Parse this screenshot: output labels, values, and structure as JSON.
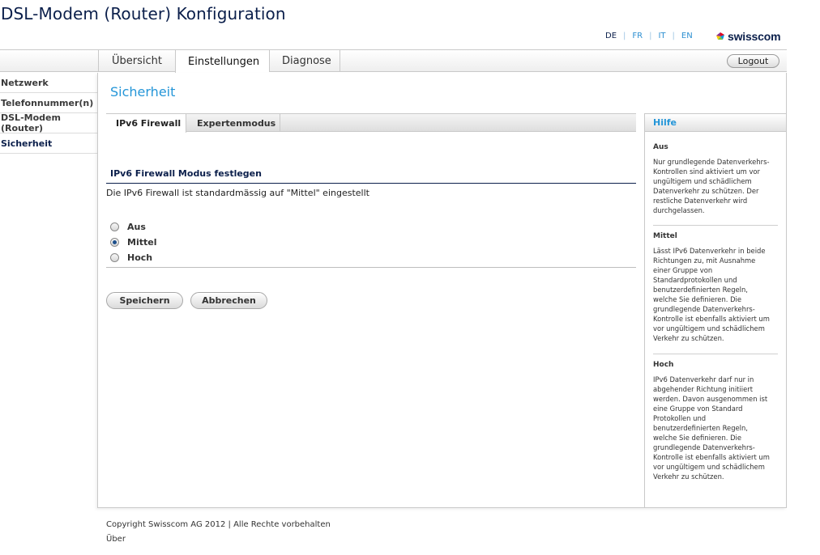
{
  "app": {
    "title": "DSL-Modem (Router) Konfiguration"
  },
  "languages": [
    {
      "code": "DE",
      "active": true
    },
    {
      "code": "FR",
      "active": false
    },
    {
      "code": "IT",
      "active": false
    },
    {
      "code": "EN",
      "active": false
    }
  ],
  "brand": {
    "name": "swisscom",
    "colors": [
      "#e2001a",
      "#0099dd",
      "#7ac143",
      "#ffcc00"
    ]
  },
  "nav": {
    "tabs": [
      {
        "label": "Übersicht"
      },
      {
        "label": "Einstellungen"
      },
      {
        "label": "Diagnose"
      }
    ],
    "logout_label": "Logout"
  },
  "sidebar": {
    "items": [
      {
        "label": "Netzwerk"
      },
      {
        "label": "Telefonnummer(n)"
      },
      {
        "label": "DSL-Modem (Router)"
      },
      {
        "label": "Sicherheit"
      }
    ]
  },
  "main": {
    "page_title": "Sicherheit",
    "subtabs": [
      {
        "label": "IPv6 Firewall"
      },
      {
        "label": "Expertenmodus"
      }
    ],
    "section_title": "IPv6 Firewall Modus festlegen",
    "section_desc": "Die IPv6 Firewall ist standardmässig auf \"Mittel\" eingestellt",
    "options": [
      {
        "label": "Aus",
        "checked": false
      },
      {
        "label": "Mittel",
        "checked": true
      },
      {
        "label": "Hoch",
        "checked": false
      }
    ],
    "save_label": "Speichern",
    "cancel_label": "Abbrechen"
  },
  "help": {
    "title": "Hilfe",
    "sections": [
      {
        "title": "Aus",
        "lines": [
          "Nur grundlegende Datenverkehrs-",
          "Kontrollen sind aktiviert um vor",
          "ungültigem und schädlichem",
          "Datenverkehr zu schützen. Der",
          "restliche Datenverkehr wird",
          "durchgelassen."
        ]
      },
      {
        "title": "Mittel",
        "lines": [
          "Lässt IPv6 Datenverkehr in beide",
          "Richtungen zu, mit Ausnahme",
          "einer Gruppe von",
          "Standardprotokollen und",
          "benutzerdefinierten Regeln,",
          "welche Sie definieren. Die",
          "grundlegende Datenverkehrs-",
          "Kontrolle ist ebenfalls aktiviert um",
          "vor ungültigem und schädlichem",
          "Verkehr zu schützen."
        ]
      },
      {
        "title": "Hoch",
        "lines": [
          "IPv6 Datenverkehr darf nur in",
          "abgehender Richtung initiiert",
          "werden. Davon ausgenommen ist",
          "eine Gruppe von Standard",
          "Protokollen und",
          "benutzerdefinierten Regeln,",
          "welche Sie definieren. Die",
          "grundlegende Datenverkehrs-",
          "Kontrolle ist ebenfalls aktiviert um",
          "vor ungültigem und schädlichem",
          "Verkehr zu schützen."
        ]
      }
    ]
  },
  "footer": {
    "copyright": "Copyright Swisscom AG 2012 | Alle Rechte vorbehalten",
    "about": "Über"
  }
}
